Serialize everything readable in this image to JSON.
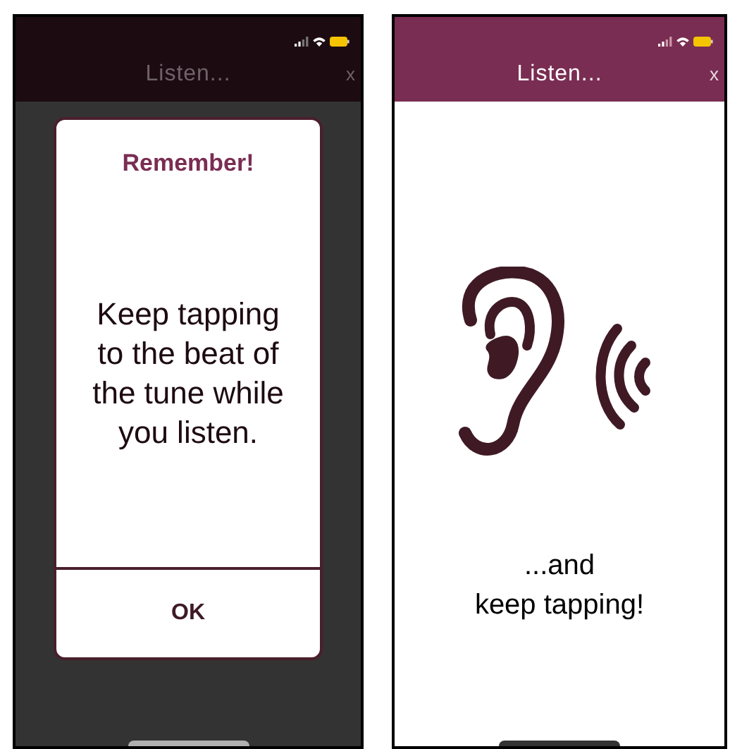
{
  "screens": [
    {
      "kind": "dialog",
      "dimmed": true,
      "header": {
        "title": "Listen...",
        "close": "x"
      },
      "dialog": {
        "title": "Remember!",
        "message": "Keep tapping to the beat of the tune while you listen.",
        "button": "OK"
      }
    },
    {
      "kind": "illustration",
      "dimmed": false,
      "header": {
        "title": "Listen...",
        "close": "x"
      },
      "caption": [
        "...and",
        "keep tapping!"
      ]
    }
  ]
}
